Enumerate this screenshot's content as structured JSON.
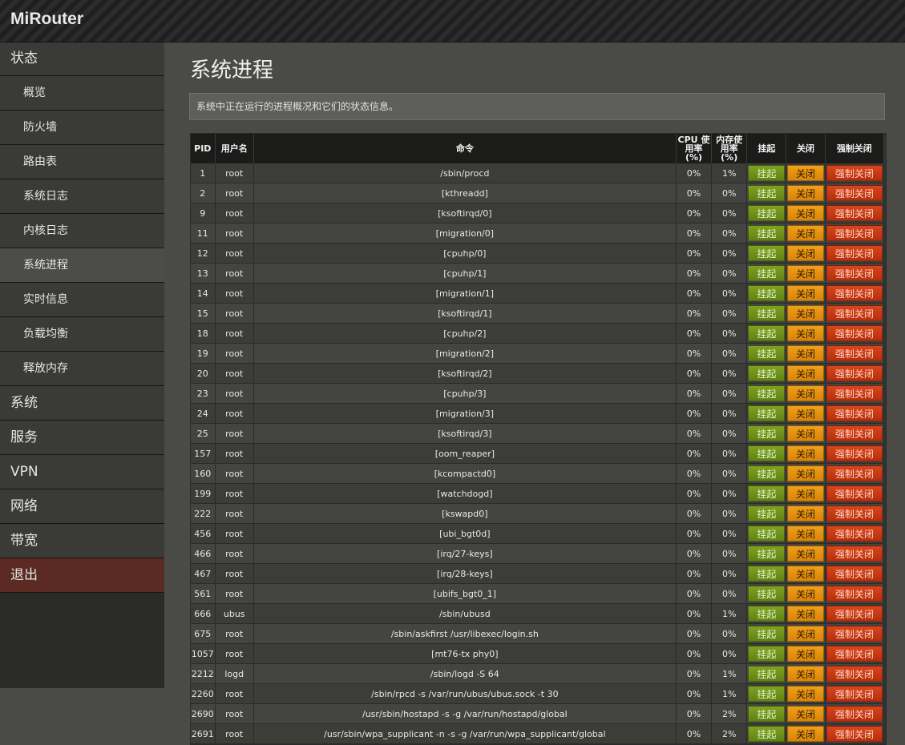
{
  "app": {
    "brand": "MiRouter"
  },
  "sidebar": {
    "status": "状态",
    "sub_items": [
      "概览",
      "防火墙",
      "路由表",
      "系统日志",
      "内核日志",
      "系统进程",
      "实时信息",
      "负载均衡",
      "释放内存"
    ],
    "active_sub": "系统进程",
    "bottom_items": [
      "系统",
      "服务",
      "VPN",
      "网络",
      "带宽"
    ],
    "logout": "退出"
  },
  "page": {
    "title": "系统进程",
    "description": "系统中正在运行的进程概况和它们的状态信息。"
  },
  "table": {
    "headers": {
      "pid": "PID",
      "user": "用户名",
      "command": "命令",
      "cpu": "CPU 使用率 (%)",
      "mem": "内存使用率 (%)",
      "suspend": "挂起",
      "close": "关闭",
      "kill": "强制关闭"
    },
    "button_labels": {
      "suspend": "挂起",
      "close": "关闭",
      "kill": "强制关闭"
    },
    "rows": [
      {
        "pid": "1",
        "user": "root",
        "cmd": "/sbin/procd",
        "cpu": "0%",
        "mem": "1%"
      },
      {
        "pid": "2",
        "user": "root",
        "cmd": "[kthreadd]",
        "cpu": "0%",
        "mem": "0%"
      },
      {
        "pid": "9",
        "user": "root",
        "cmd": "[ksoftirqd/0]",
        "cpu": "0%",
        "mem": "0%"
      },
      {
        "pid": "11",
        "user": "root",
        "cmd": "[migration/0]",
        "cpu": "0%",
        "mem": "0%"
      },
      {
        "pid": "12",
        "user": "root",
        "cmd": "[cpuhp/0]",
        "cpu": "0%",
        "mem": "0%"
      },
      {
        "pid": "13",
        "user": "root",
        "cmd": "[cpuhp/1]",
        "cpu": "0%",
        "mem": "0%"
      },
      {
        "pid": "14",
        "user": "root",
        "cmd": "[migration/1]",
        "cpu": "0%",
        "mem": "0%"
      },
      {
        "pid": "15",
        "user": "root",
        "cmd": "[ksoftirqd/1]",
        "cpu": "0%",
        "mem": "0%"
      },
      {
        "pid": "18",
        "user": "root",
        "cmd": "[cpuhp/2]",
        "cpu": "0%",
        "mem": "0%"
      },
      {
        "pid": "19",
        "user": "root",
        "cmd": "[migration/2]",
        "cpu": "0%",
        "mem": "0%"
      },
      {
        "pid": "20",
        "user": "root",
        "cmd": "[ksoftirqd/2]",
        "cpu": "0%",
        "mem": "0%"
      },
      {
        "pid": "23",
        "user": "root",
        "cmd": "[cpuhp/3]",
        "cpu": "0%",
        "mem": "0%"
      },
      {
        "pid": "24",
        "user": "root",
        "cmd": "[migration/3]",
        "cpu": "0%",
        "mem": "0%"
      },
      {
        "pid": "25",
        "user": "root",
        "cmd": "[ksoftirqd/3]",
        "cpu": "0%",
        "mem": "0%"
      },
      {
        "pid": "157",
        "user": "root",
        "cmd": "[oom_reaper]",
        "cpu": "0%",
        "mem": "0%"
      },
      {
        "pid": "160",
        "user": "root",
        "cmd": "[kcompactd0]",
        "cpu": "0%",
        "mem": "0%"
      },
      {
        "pid": "199",
        "user": "root",
        "cmd": "[watchdogd]",
        "cpu": "0%",
        "mem": "0%"
      },
      {
        "pid": "222",
        "user": "root",
        "cmd": "[kswapd0]",
        "cpu": "0%",
        "mem": "0%"
      },
      {
        "pid": "456",
        "user": "root",
        "cmd": "[ubi_bgt0d]",
        "cpu": "0%",
        "mem": "0%"
      },
      {
        "pid": "466",
        "user": "root",
        "cmd": "[irq/27-keys]",
        "cpu": "0%",
        "mem": "0%"
      },
      {
        "pid": "467",
        "user": "root",
        "cmd": "[irq/28-keys]",
        "cpu": "0%",
        "mem": "0%"
      },
      {
        "pid": "561",
        "user": "root",
        "cmd": "[ubifs_bgt0_1]",
        "cpu": "0%",
        "mem": "0%"
      },
      {
        "pid": "666",
        "user": "ubus",
        "cmd": "/sbin/ubusd",
        "cpu": "0%",
        "mem": "1%"
      },
      {
        "pid": "675",
        "user": "root",
        "cmd": "/sbin/askfirst /usr/libexec/login.sh",
        "cpu": "0%",
        "mem": "0%"
      },
      {
        "pid": "1057",
        "user": "root",
        "cmd": "[mt76-tx phy0]",
        "cpu": "0%",
        "mem": "0%"
      },
      {
        "pid": "2212",
        "user": "logd",
        "cmd": "/sbin/logd -S 64",
        "cpu": "0%",
        "mem": "1%"
      },
      {
        "pid": "2260",
        "user": "root",
        "cmd": "/sbin/rpcd -s /var/run/ubus/ubus.sock -t 30",
        "cpu": "0%",
        "mem": "1%"
      },
      {
        "pid": "2690",
        "user": "root",
        "cmd": "/usr/sbin/hostapd -s -g /var/run/hostapd/global",
        "cpu": "0%",
        "mem": "2%"
      },
      {
        "pid": "2691",
        "user": "root",
        "cmd": "/usr/sbin/wpa_supplicant -n -s -g /var/run/wpa_supplicant/global",
        "cpu": "0%",
        "mem": "2%"
      }
    ]
  },
  "colors": {
    "suspend_button": "#6e9219",
    "close_button": "#e4910f",
    "kill_button": "#c83a12",
    "logout_item": "#5b2a22"
  }
}
